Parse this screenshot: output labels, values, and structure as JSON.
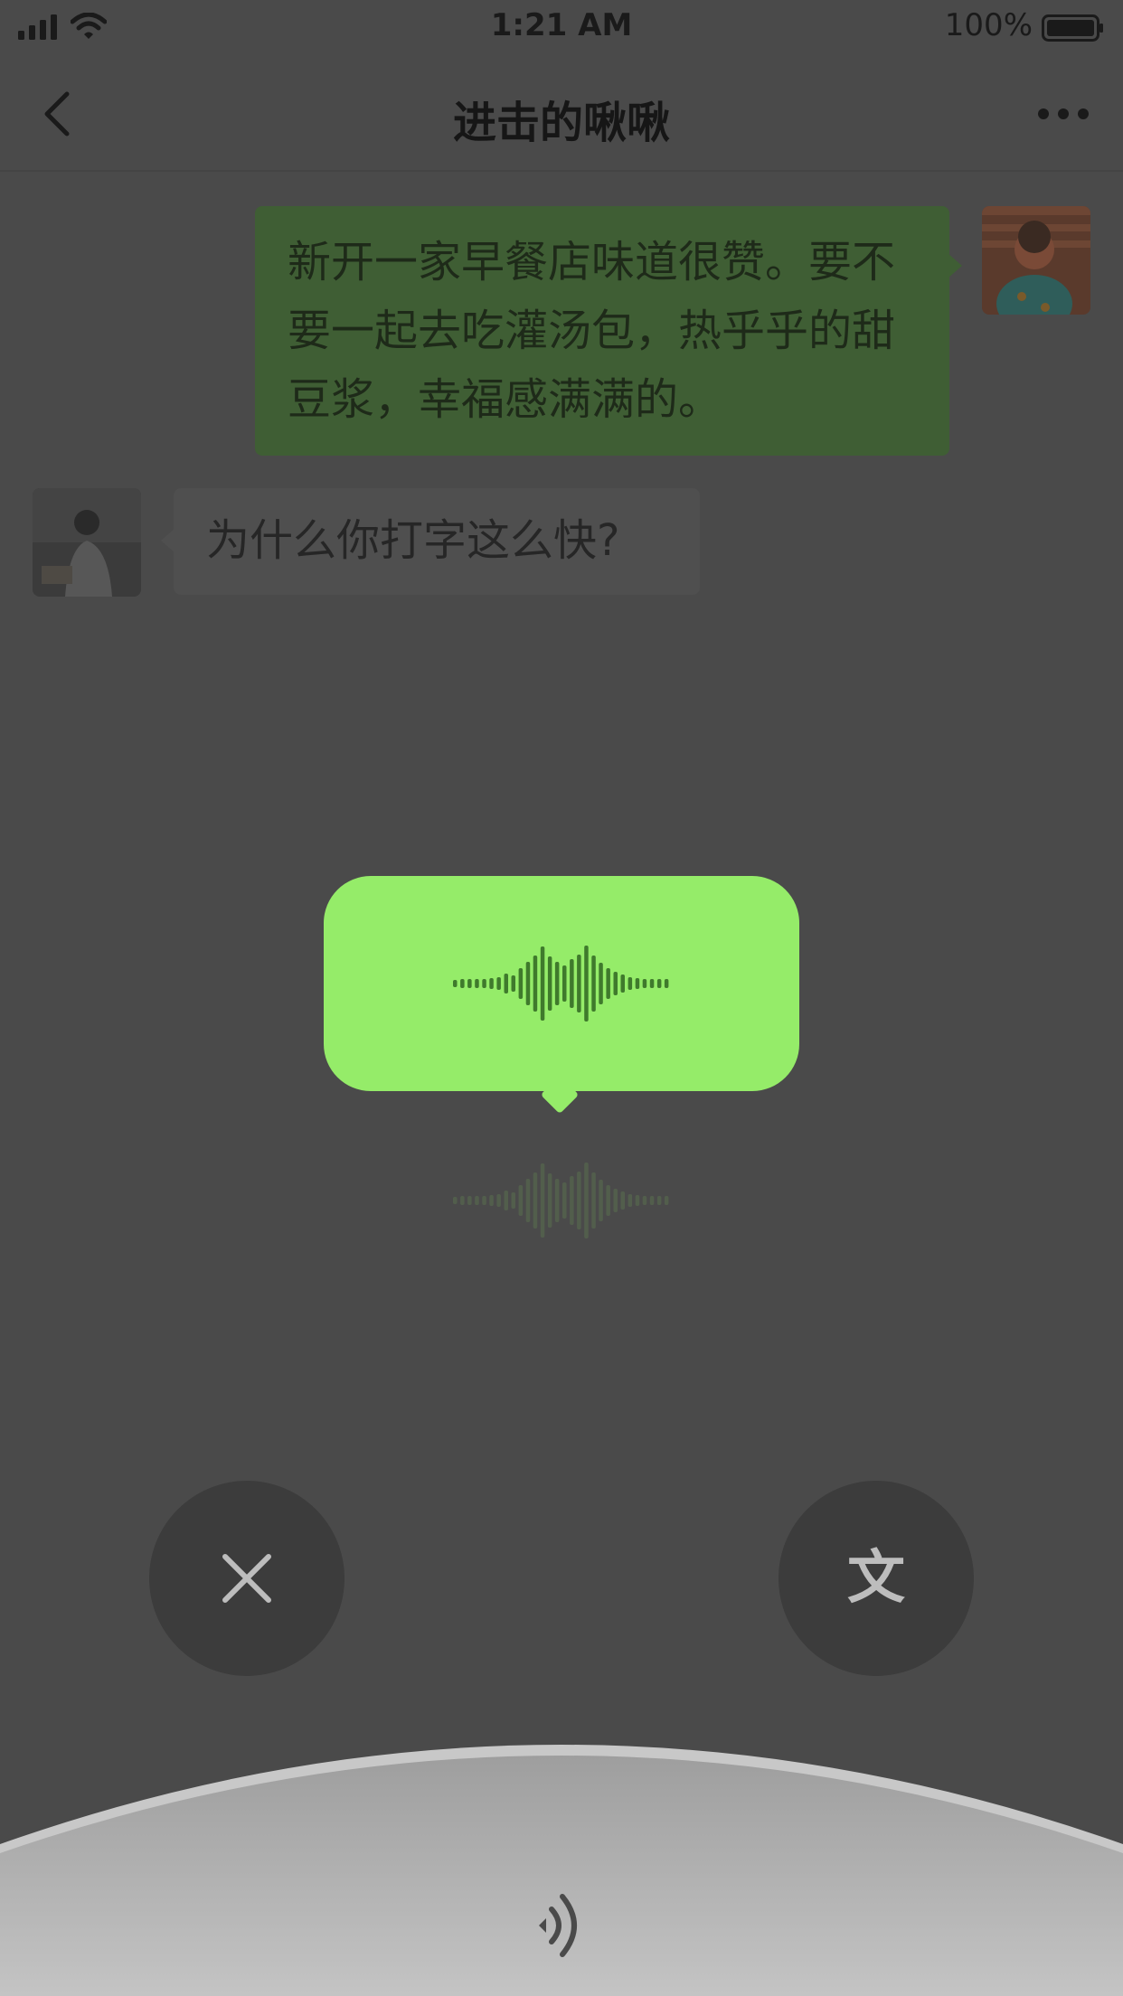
{
  "status_bar": {
    "time": "1:21 AM",
    "battery": "100%"
  },
  "header": {
    "title": "进击的啾啾"
  },
  "messages": [
    {
      "side": "right",
      "text": "新开一家早餐店味道很赞。要不要一起去吃灌汤包，热乎乎的甜豆浆，幸福感满满的。"
    },
    {
      "side": "left",
      "text": "为什么你打字这么快?"
    }
  ],
  "recording": {
    "state": "recording"
  },
  "controls": {
    "cancel_icon": "close-icon",
    "convert_label": "文",
    "speaker_icon": "speaker-icon"
  },
  "colors": {
    "background": "#4a4a4a",
    "recording_bubble": "#95ec69",
    "outgoing_bubble": "#3f5e34",
    "incoming_bubble": "#4f4f4f"
  }
}
